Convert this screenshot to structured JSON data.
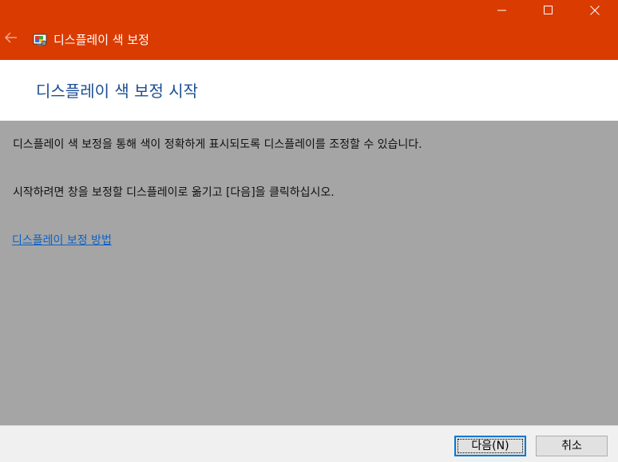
{
  "window": {
    "title": "디스플레이 색 보정",
    "controls": [
      "minimize-icon",
      "maximize-icon",
      "close-icon"
    ],
    "accent_color": "#da3b01"
  },
  "header": {
    "title": "디스플레이 색 보정 시작",
    "title_color": "#1c4f94"
  },
  "content": {
    "paragraph1": "디스플레이 색 보정을 통해 색이 정확하게 표시되도록 디스플레이를 조정할 수 있습니다.",
    "paragraph2": "시작하려면 창을 보정할 디스플레이로 옮기고 [다음]을 클릭하십시오.",
    "link": "디스플레이 보정 방법",
    "link_color": "#0a62c9"
  },
  "footer": {
    "next_label": "다음(N)",
    "cancel_label": "취소"
  }
}
